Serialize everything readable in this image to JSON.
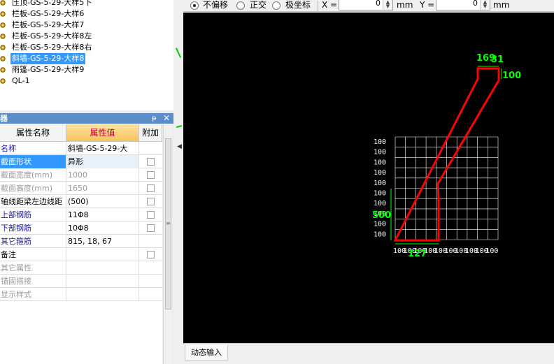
{
  "tree": {
    "items": [
      {
        "label": "压顶-GS-5-29-大样5下",
        "selected": false,
        "icon": "gear-icon"
      },
      {
        "label": "栏板-GS-5-29-大样6",
        "selected": false,
        "icon": "gear-icon"
      },
      {
        "label": "栏板-GS-5-29-大样7",
        "selected": false,
        "icon": "gear-icon"
      },
      {
        "label": "栏板-GS-5-29-大样8左",
        "selected": false,
        "icon": "gear-icon"
      },
      {
        "label": "栏板-GS-5-29-大样8右",
        "selected": false,
        "icon": "gear-icon"
      },
      {
        "label": "斜墙-GS-5-29-大样8",
        "selected": true,
        "icon": "gear-icon"
      },
      {
        "label": "雨篷-GS-5-29-大样9",
        "selected": false,
        "icon": "gear-icon"
      },
      {
        "label": "QL-1",
        "selected": false,
        "icon": "gear-icon"
      }
    ]
  },
  "props_panel": {
    "title": "器",
    "pin_glyph": "ᵽ",
    "close_glyph": "✕",
    "headers": {
      "name": "属性名称",
      "value": "属性值",
      "extra": "附加"
    },
    "rows": [
      {
        "name": "名称",
        "value": "斜墙-GS-5-29-大",
        "style": "blue",
        "check": false
      },
      {
        "name": "截面形状",
        "value": "异形",
        "style": "blue sel",
        "check": true
      },
      {
        "name": "截面宽度(mm)",
        "value": "1000",
        "style": "gray",
        "check": true
      },
      {
        "name": "截面高度(mm)",
        "value": "1650",
        "style": "gray",
        "check": true
      },
      {
        "name": "轴线距梁左边线距",
        "value": "(500)",
        "style": "normal",
        "check": true
      },
      {
        "name": "上部钢筋",
        "value": "11Φ8",
        "style": "blue",
        "check": true
      },
      {
        "name": "下部钢筋",
        "value": "10Φ8",
        "style": "blue",
        "check": true
      },
      {
        "name": "其它箍筋",
        "value": "815, 18, 67",
        "style": "blue",
        "check": false
      },
      {
        "name": "备注",
        "value": "",
        "style": "normal",
        "check": true
      },
      {
        "name": "其它属性",
        "value": "",
        "style": "gray",
        "check": false
      },
      {
        "name": "锚固搭接",
        "value": "",
        "style": "gray",
        "check": false
      },
      {
        "name": "显示样式",
        "value": "",
        "style": "gray",
        "check": false
      }
    ]
  },
  "toolbar": {
    "opt_no_offset": "不偏移",
    "opt_orthogonal": "正交",
    "opt_polar": "极坐标",
    "x_label": "X =",
    "x_value": "0",
    "y_label": "Y =",
    "y_value": "0",
    "unit": "mm",
    "selected_option": "不偏移"
  },
  "bottom": {
    "dynamic_input_tab": "动态输入"
  },
  "canvas": {
    "grid_left_labels": [
      "100",
      "100",
      "100",
      "100",
      "100",
      "100",
      "100",
      "100",
      "100",
      "100"
    ],
    "grid_bottom_labels": [
      "100",
      "100",
      "100",
      "100",
      "100",
      "100",
      "100",
      "100",
      "100",
      "100"
    ],
    "dim_top_width": "169",
    "dim_top_right": "31",
    "dim_top_height": "100",
    "dim_left_height": "500",
    "dim_bottom_width": "127",
    "shape_color": "#ff0000",
    "dim_color": "#00ff00",
    "grid_color": "#ffffff"
  }
}
